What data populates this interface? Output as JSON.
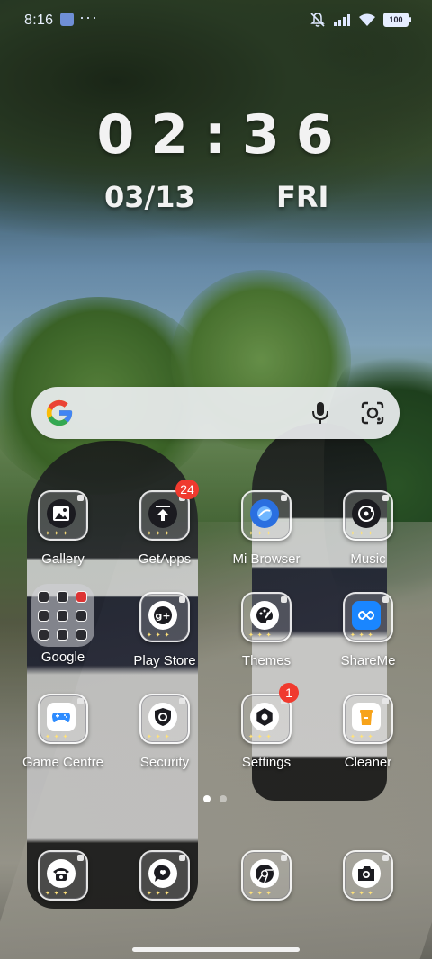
{
  "status_bar": {
    "time": "8:16",
    "more": "···",
    "battery": "100",
    "icons": [
      "app-notification-icon",
      "mute-icon",
      "signal-icon",
      "wifi-icon",
      "battery-icon"
    ]
  },
  "clock": {
    "time": "02:36",
    "date": "03/13",
    "day": "FRI"
  },
  "search_bar": {
    "icons": [
      "google-logo-icon",
      "microphone-icon",
      "google-lens-icon"
    ]
  },
  "apps": {
    "row1": [
      {
        "label": "Gallery",
        "icon": "gallery-icon"
      },
      {
        "label": "GetApps",
        "icon": "getapps-icon",
        "badge": "24"
      },
      {
        "label": "Mi Browser",
        "icon": "browser-icon"
      },
      {
        "label": "Music",
        "icon": "music-icon"
      }
    ],
    "row2": [
      {
        "label": "Google",
        "icon": "folder-icon"
      },
      {
        "label": "Play Store",
        "icon": "play-store-icon"
      },
      {
        "label": "Themes",
        "icon": "themes-palette-icon"
      },
      {
        "label": "ShareMe",
        "icon": "shareme-icon"
      }
    ],
    "row3": [
      {
        "label": "Game Centre",
        "icon": "gamepad-icon"
      },
      {
        "label": "Security",
        "icon": "security-shield-icon"
      },
      {
        "label": "Settings",
        "icon": "settings-gear-icon",
        "badge": "1"
      },
      {
        "label": "Cleaner",
        "icon": "trash-cleaner-icon"
      }
    ]
  },
  "dock": [
    {
      "icon": "phone-icon"
    },
    {
      "icon": "messages-icon"
    },
    {
      "icon": "chrome-icon"
    },
    {
      "icon": "camera-icon"
    }
  ],
  "pager": {
    "pages": 2,
    "current": 1
  },
  "colors": {
    "badge": "#f03a2e",
    "google_blue": "#4285F4",
    "google_red": "#EA4335",
    "google_yellow": "#FBBC05",
    "google_green": "#34A853"
  }
}
